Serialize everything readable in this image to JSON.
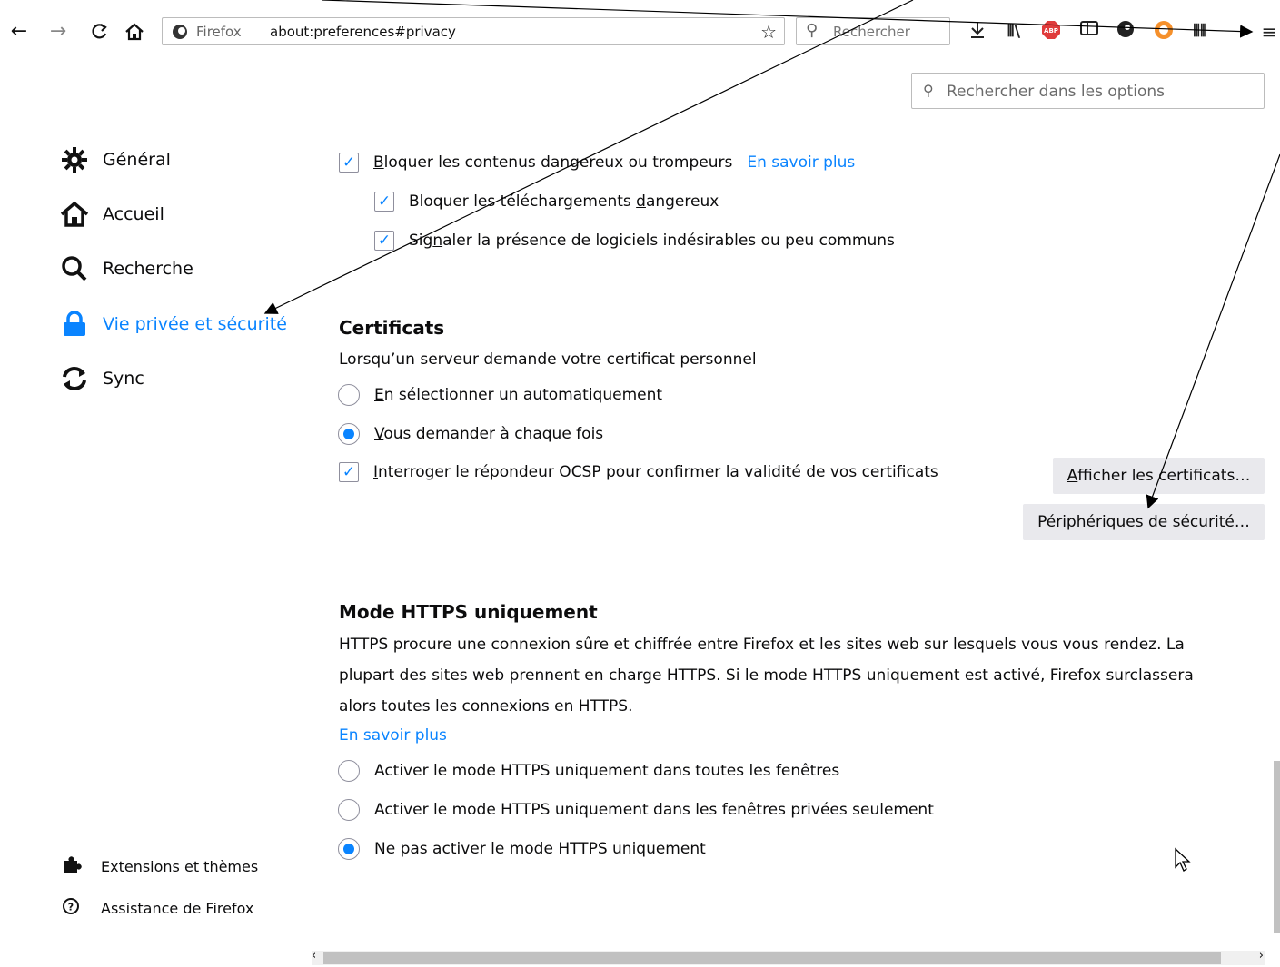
{
  "toolbar": {
    "firefox_label": "Firefox",
    "url": "about:preferences#privacy",
    "search_placeholder": "Rechercher"
  },
  "options_search": {
    "placeholder": "Rechercher dans les options"
  },
  "sidebar": {
    "items": [
      {
        "label": "Général",
        "icon": "gear-icon"
      },
      {
        "label": "Accueil",
        "icon": "home-icon"
      },
      {
        "label": "Recherche",
        "icon": "search-icon"
      },
      {
        "label": "Vie privée et sécurité",
        "icon": "lock-icon",
        "active": true
      },
      {
        "label": "Sync",
        "icon": "sync-icon"
      }
    ],
    "footer": [
      {
        "label": "Extensions et thèmes",
        "icon": "puzzle-icon"
      },
      {
        "label": "Assistance de Firefox",
        "icon": "help-icon"
      }
    ]
  },
  "protection": {
    "block_dangerous": {
      "pre": "",
      "mnemonic": "B",
      "post": "loquer les contenus dangereux ou trompeurs",
      "checked": true
    },
    "learn_more": "En savoir plus",
    "block_downloads": {
      "pre": "Bloquer les téléchargements ",
      "mnemonic": "d",
      "post": "angereux",
      "checked": true
    },
    "warn_unwanted": {
      "pre": "Sig",
      "mnemonic": "n",
      "post": "aler la présence de logiciels indésirables ou peu communs",
      "checked": true
    }
  },
  "certificates": {
    "heading": "Certificats",
    "description": "Lorsqu’un serveur demande votre certificat personnel",
    "auto_select": {
      "pre": "",
      "mnemonic": "E",
      "post": "n sélectionner un automatiquement",
      "selected": false
    },
    "ask_every_time": {
      "pre": "",
      "mnemonic": "V",
      "post": "ous demander à chaque fois",
      "selected": true
    },
    "ocsp": {
      "pre": "",
      "mnemonic": "I",
      "post": "nterroger le répondeur OCSP pour confirmer la validité de vos certificats",
      "checked": true
    },
    "view_button": {
      "pre": "",
      "mnemonic": "A",
      "post": "fficher les certificats…"
    },
    "devices_button": {
      "pre": "",
      "mnemonic": "P",
      "post": "ériphériques de sécurité…"
    }
  },
  "https_only": {
    "heading": "Mode HTTPS uniquement",
    "description_lines": [
      "HTTPS procure une connexion sûre et chiffrée entre Firefox et les sites web sur lesquels vous vous rendez. La",
      "plupart des sites web prennent en charge HTTPS. Si le mode HTTPS uniquement est activé, Firefox surclassera",
      "alors toutes les connexions en HTTPS."
    ],
    "learn_more": "En savoir plus",
    "options": [
      {
        "label": "Activer le mode HTTPS uniquement dans toutes les fenêtres",
        "selected": false
      },
      {
        "label": "Activer le mode HTTPS uniquement dans les fenêtres privées seulement",
        "selected": false
      },
      {
        "label": "Ne pas activer le mode HTTPS uniquement",
        "selected": true
      }
    ]
  },
  "colors": {
    "accent": "#0a84ff",
    "button_bg": "#e9e9ed"
  }
}
